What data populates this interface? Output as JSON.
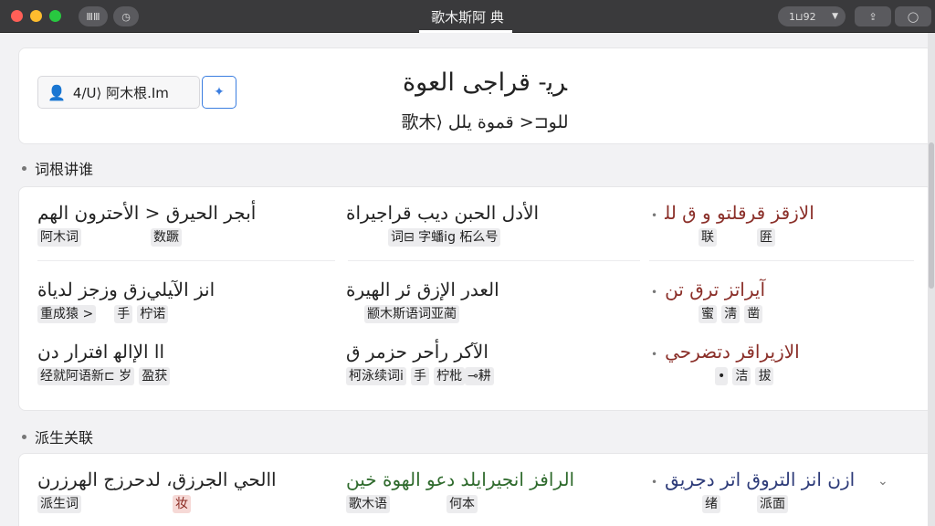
{
  "window": {
    "title": "歌木斯阿 典",
    "left_btn": "ⅢⅢ",
    "zoom": "1⊔92"
  },
  "colors": {
    "close": "#ff5f57",
    "min": "#febc2e",
    "max": "#28c840",
    "accent": "#3b7ee0"
  },
  "header": {
    "field_value": "4/U⟩ 阿木根.Im",
    "title": "ﺮﻳ- ﻗﺮﺍﺟﻰ ﺍﻟﻌﻮﺓ",
    "subtitle": "歌木⟩ ﻟﻠﻮ⊏< ﻗﻤﻮﺓ ﻳﻠﻞ"
  },
  "sections": {
    "roots": "词根讲谁",
    "derived": "派生关联"
  },
  "roots_grid": [
    {
      "term": "ﺃﺑﺠﺮ ﺍﻟﺤﻴﺮﻕ < ﺍﻷﺣﺘﺮﻭﻥ ﺍﻟﻬﻢ",
      "tags": [
        "阿木词",
        "数蹶"
      ],
      "tone": "plain"
    },
    {
      "term": "ﺍﻷﺩﻝ ﺍﻟﺤﺒﻦ ﺩﻳﺐ ﻗﺮﺍﺟﻴﺮﺍﺓ",
      "tags": [
        "词⊟ 字蟠ig 柘么号"
      ],
      "tone": "plain"
    },
    {
      "term": "ﺍﻻﺯﻗﺰ ﻗﺮﻗﻠﺘﻮ ﻭ ﻕ ﻟﻠ",
      "tags": [
        "联",
        "匥"
      ],
      "tone": "red",
      "dot": "•"
    },
    {
      "term": "ﺍﻧﺰ ﺍﻵﻴﻠﻲﺯﻕ ﻭﺯﺟﺰ ﻟﺪﻳﺎﺓ",
      "tags": [
        "重成猿 >",
        "手",
        "柠诺"
      ],
      "tone": "plain"
    },
    {
      "term": "ﺍﻟﻌﺪﺭ ﺍﻹﺯﻕ ﺋﺮ ﺍﻟﻬﻴﺮﺓ",
      "tags": [
        "颛木斯语词亚蔺"
      ],
      "tone": "plain"
    },
    {
      "term": "ﺁﻳﺮﺍﺗﺰ ﺗﺮﻕ ﺗﻦ",
      "tags": [
        "蜜",
        "淸",
        "凿"
      ],
      "tone": "red",
      "dot": "•"
    },
    {
      "term": "ﺍﺍ ﺍﻹﺍﻟﻬ ﺍﻓﺘﺮﺍﺭ ﺩﻥ",
      "tags": [
        "经就阿语新⊏ 岁",
        "盈获"
      ],
      "tone": "plain"
    },
    {
      "term": "ﺍﻵﻛﺮ ﺭﺃﺣﺮ ﺣﺰﻣﺮ ﻕ",
      "tags": [
        "柯泳续词i",
        "手",
        "柠枇",
        "⊸耕"
      ],
      "tone": "plain"
    },
    {
      "term": "ﺍﻻﺯﻳﺮﺍﻗﺮ ﺩﺗﻀﺮﺣﻲ",
      "tags": [
        "•",
        "洁",
        "拔"
      ],
      "tone": "red",
      "dot": "•"
    }
  ],
  "derived_row": [
    {
      "term": "ﺍﺍﻟﺤﻲ ﺍﻟﺠﺮﺯﻕ، ﻟﺪﺣﺮﺯﺝ ﺍﻟﻬﺮﺯﺭﻥ",
      "tags": [
        "派生词",
        "妆"
      ],
      "tone": "mixed"
    },
    {
      "term": "ﺍﻟﺮﺍﻓﺰ ﺍﻧﺠﻴﺮﺍﻳﻠﺪ ﺩﻋﻮ ﺍﻟﻬﻮﺓ ﺧﻴﻦ",
      "tags": [
        "歌木语",
        "何本"
      ],
      "tone": "green"
    },
    {
      "term": "ﺍﺯﻥ ﺍﻧﺰ ﺍﻟﺘﺮﻭﻕ ﺍﺗﺮ ﺩﺟﺮﻳﻖ",
      "tags": [
        "绪",
        "派面"
      ],
      "tone": "blue",
      "dot": "•"
    }
  ]
}
